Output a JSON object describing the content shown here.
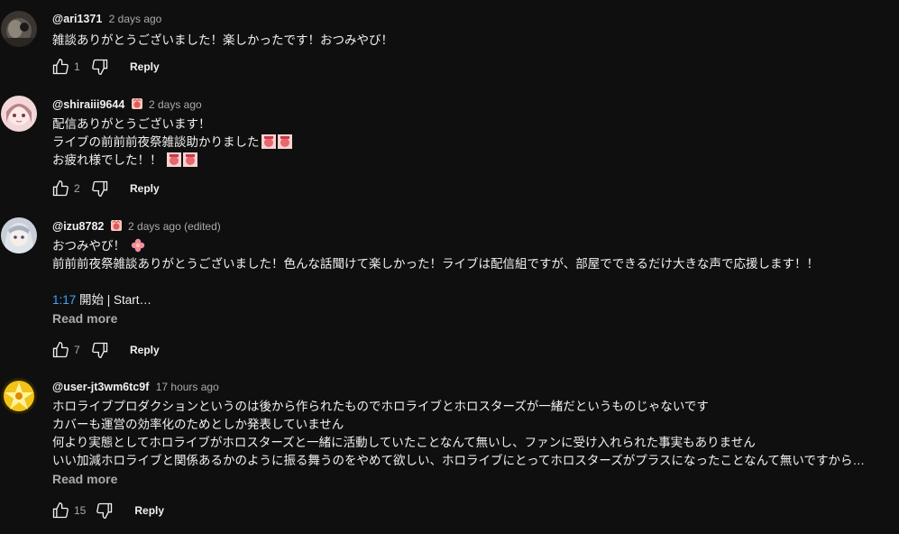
{
  "comments": [
    {
      "author": "@ari1371",
      "time": "2 days ago",
      "lines": [
        "雑談ありがとうございました！楽しかったです！おつみやび！"
      ],
      "likes": "1",
      "reply_label": "Reply"
    },
    {
      "author": "@shiraiii9644",
      "time": "2 days ago",
      "lines": [
        "配信ありがとうございます！",
        "ライブの前前前夜祭雑談助かりました",
        "お疲れ様でした！！"
      ],
      "likes": "2",
      "reply_label": "Reply"
    },
    {
      "author": "@izu8782",
      "time": "2 days ago (edited)",
      "lines": [
        "おつみやび！",
        "前前前夜祭雑談ありがとうございました！色んな話聞けて楽しかった！ライブは配信組ですが、部屋でできるだけ大きな声で応援します！！"
      ],
      "timestamp": "1:17",
      "timestamp_text": " 開始 | Start…",
      "read_more": "Read more",
      "likes": "7",
      "reply_label": "Reply"
    },
    {
      "author": "@user-jt3wm6tc9f",
      "time": "17 hours ago",
      "lines": [
        "ホロライブプロダクションというのは後から作られたものでホロライブとホロスターズが一緒だというものじゃないです",
        "カバーも運営の効率化のためとしか発表していません",
        "何より実態としてホロライブがホロスターズと一緒に活動していたことなんて無いし、ファンに受け入れられた事実もありません",
        "いい加減ホロライブと関係あるかのように振る舞うのをやめて欲しい、ホロライブにとってホロスターズがプラスになったことなんて無いですから…"
      ],
      "read_more": "Read more",
      "likes": "15",
      "reply_label": "Reply"
    }
  ],
  "icons": {
    "like": "thumbs-up-icon",
    "dislike": "thumbs-down-icon",
    "badge": "member-badge-icon",
    "emoji": "custom-emoji-icon",
    "flower": "flower-emoji-icon"
  },
  "colors": {
    "background": "#0f0f0f",
    "text": "#f1f1f1",
    "secondary": "#aaaaaa",
    "link": "#3ea6ff"
  }
}
